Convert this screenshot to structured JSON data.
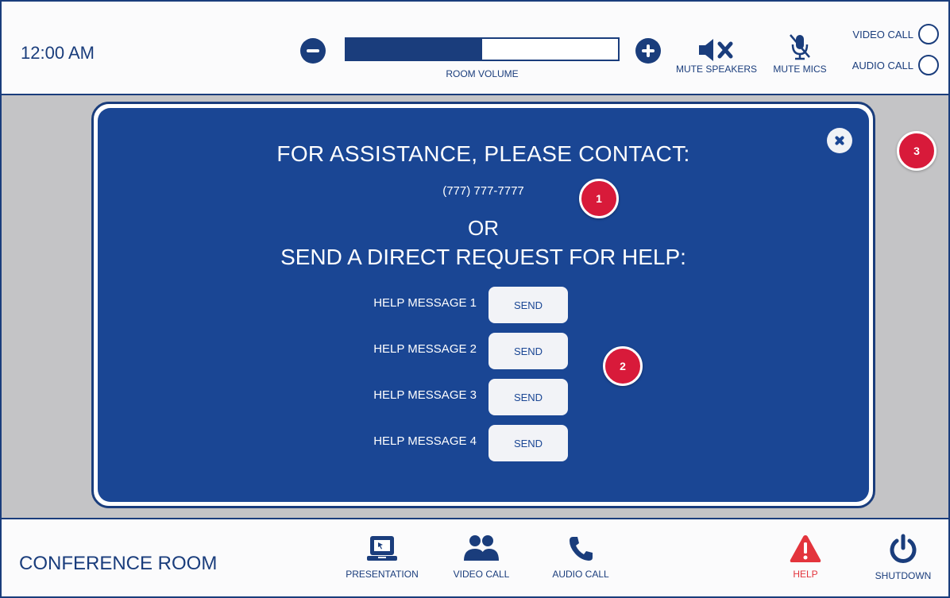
{
  "header": {
    "clock": "12:00 AM",
    "volume_label": "ROOM VOLUME",
    "volume_level": 0.5,
    "mute_speakers_label": "MUTE SPEAKERS",
    "mute_mics_label": "MUTE MICS",
    "video_call_label": "VIDEO CALL",
    "audio_call_label": "AUDIO CALL"
  },
  "modal": {
    "title": "FOR ASSISTANCE, PLEASE CONTACT:",
    "phone": "(777) 777-7777",
    "or_text": "OR",
    "send_title": "SEND A DIRECT REQUEST FOR HELP:",
    "help_messages": [
      {
        "label": "HELP MESSAGE 1",
        "button": "SEND"
      },
      {
        "label": "HELP MESSAGE 2",
        "button": "SEND"
      },
      {
        "label": "HELP MESSAGE 3",
        "button": "SEND"
      },
      {
        "label": "HELP MESSAGE 4",
        "button": "SEND"
      }
    ]
  },
  "badges": [
    "1",
    "2",
    "3"
  ],
  "footer": {
    "room_name": "CONFERENCE ROOM",
    "nav": [
      {
        "label": "PRESENTATION",
        "icon": "laptop-icon"
      },
      {
        "label": "VIDEO CALL",
        "icon": "people-icon"
      },
      {
        "label": "AUDIO CALL",
        "icon": "phone-icon"
      },
      {
        "label": "HELP",
        "icon": "warning-icon"
      },
      {
        "label": "SHUTDOWN",
        "icon": "power-icon"
      }
    ]
  },
  "colors": {
    "primary": "#1a3d7c",
    "modal_bg": "#1a4694",
    "overlay_bg": "#c4c4c6",
    "badge": "#d81a3a",
    "help_red": "#e3343c"
  }
}
